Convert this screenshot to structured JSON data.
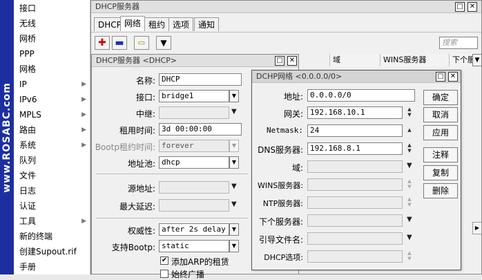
{
  "brand": {
    "text": "www.ROSABC.com"
  },
  "menu": {
    "items": [
      {
        "label": "接口",
        "arrow": ""
      },
      {
        "label": "无线",
        "arrow": ""
      },
      {
        "label": "网桥",
        "arrow": ""
      },
      {
        "label": "PPP",
        "arrow": ""
      },
      {
        "label": "网格",
        "arrow": ""
      },
      {
        "label": "IP",
        "arrow": "▶"
      },
      {
        "label": "IPv6",
        "arrow": "▶"
      },
      {
        "label": "MPLS",
        "arrow": "▶"
      },
      {
        "label": "路由",
        "arrow": "▶"
      },
      {
        "label": "系统",
        "arrow": "▶"
      },
      {
        "label": "队列",
        "arrow": ""
      },
      {
        "label": "文件",
        "arrow": ""
      },
      {
        "label": "日志",
        "arrow": ""
      },
      {
        "label": "认证",
        "arrow": ""
      },
      {
        "label": "工具",
        "arrow": "▶"
      },
      {
        "label": "新的终端",
        "arrow": ""
      },
      {
        "label": "创建Supout.rif",
        "arrow": ""
      },
      {
        "label": "手册",
        "arrow": ""
      }
    ]
  },
  "dhcp_server_window": {
    "title": "DHCP服务器",
    "close": "✕",
    "maximize": "□",
    "tabs": [
      "DHCP",
      "网络",
      "租约",
      "选项",
      "通知"
    ],
    "search_placeholder": "搜索",
    "columns": {
      "domain": "域",
      "wins": "WINS服务器",
      "next": "下个服"
    },
    "scroll_right": "▶"
  },
  "dhcp_edit_window": {
    "title": "DHCP服务器 <DHCP>",
    "fields": {
      "name": {
        "label": "名称:",
        "value": "DHCP"
      },
      "interface": {
        "label": "接口:",
        "value": "bridge1"
      },
      "relay": {
        "label": "中继:",
        "value": ""
      },
      "lease_time": {
        "label": "租用时间:",
        "value": "3d 00:00:00"
      },
      "bootp_lease": {
        "label": "Bootp租约时间:",
        "value": "forever"
      },
      "pool": {
        "label": "地址池:",
        "value": "dhcp"
      },
      "src_addr": {
        "label": "源地址:",
        "value": ""
      },
      "delay": {
        "label": "最大延迟:",
        "value": ""
      },
      "authoritative": {
        "label": "权威性:",
        "value": "after 2s delay"
      },
      "bootp_support": {
        "label": "支持Bootp:",
        "value": "static"
      },
      "add_arp": {
        "label": "添加ARP的租赁",
        "checked": true
      },
      "always_broadcast": {
        "label": "始终广播",
        "checked": false
      }
    }
  },
  "network_window": {
    "title": "DCHP网络 <0.0.0.0/0>",
    "fields": {
      "address": {
        "label": "地址:",
        "value": "0.0.0.0/0"
      },
      "gateway": {
        "label": "网关:",
        "value": "192.168.10.1"
      },
      "netmask": {
        "label": "Netmask:",
        "value": "24"
      },
      "dns": {
        "label": "DNS服务器:",
        "value": "192.168.8.1"
      },
      "domain": {
        "label": "域:",
        "value": ""
      },
      "wins": {
        "label": "WINS服务器:",
        "value": ""
      },
      "ntp": {
        "label": "NTP服务器:",
        "value": ""
      },
      "next_server": {
        "label": "下个服务器:",
        "value": ""
      },
      "boot_file": {
        "label": "引导文件名:",
        "value": ""
      },
      "dhcp_option": {
        "label": "DHCP选项:",
        "value": ""
      }
    },
    "buttons": {
      "ok": "确定",
      "cancel": "取消",
      "apply": "应用",
      "comment": "注释",
      "copy": "复制",
      "remove": "删除"
    }
  },
  "colors": {
    "brand_bg": "#1d2fa0",
    "add_red": "#cc0000",
    "remove_blue": "#1a2fbf"
  }
}
